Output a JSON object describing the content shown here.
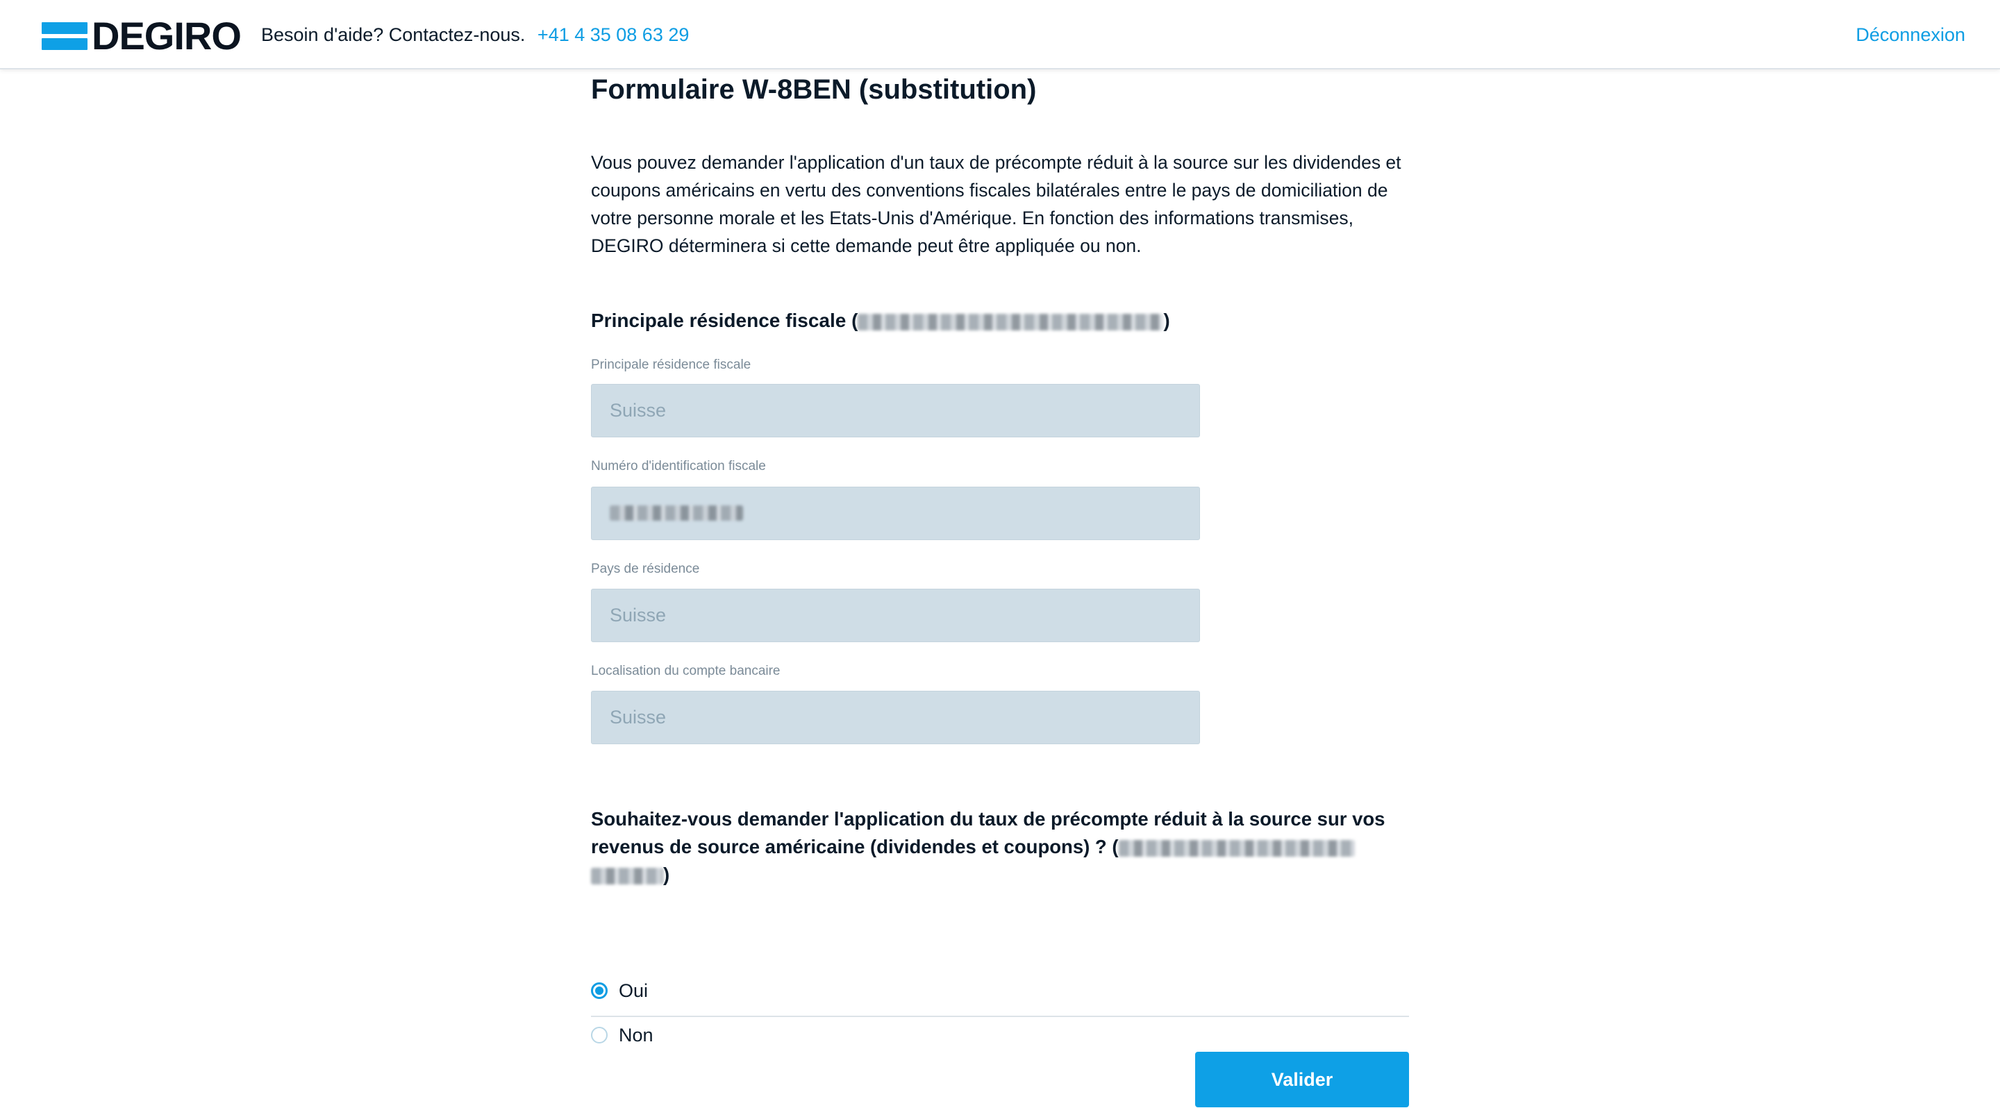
{
  "header": {
    "logo_text": "DEGIRO",
    "help_text": "Besoin d'aide? Contactez-nous.",
    "phone": "+41 4 35 08 63 29",
    "logout_label": "Déconnexion",
    "accent_color": "#0ea0e6"
  },
  "form": {
    "title": "Formulaire W-8BEN (substitution)",
    "intro": "Vous pouvez demander l'application d'un taux de précompte réduit à la source sur les dividendes et coupons américains en vertu des conventions fiscales bilatérales entre le pays de domiciliation de votre personne morale et les Etats-Unis d'Amérique. En fonction des informations transmises, DEGIRO déterminera si cette demande peut être appliquée ou non.",
    "section_title": "Principale résidence fiscale (",
    "section_title_end": ")",
    "fields": [
      {
        "label": "Principale résidence fiscale",
        "value": "Suisse"
      },
      {
        "label": "Numéro d'identification fiscale",
        "value": ""
      },
      {
        "label": "Pays de résidence",
        "value": "Suisse"
      },
      {
        "label": "Localisation du compte bancaire",
        "value": "Suisse"
      }
    ],
    "question": "Souhaitez-vous demander l'application du taux de précompte réduit à la source sur vos revenus de source américaine (dividendes et coupons) ? (",
    "question_end": ")",
    "options": [
      {
        "label": "Oui",
        "selected": true
      },
      {
        "label": "Non",
        "selected": false
      }
    ],
    "submit_label": "Valider"
  }
}
